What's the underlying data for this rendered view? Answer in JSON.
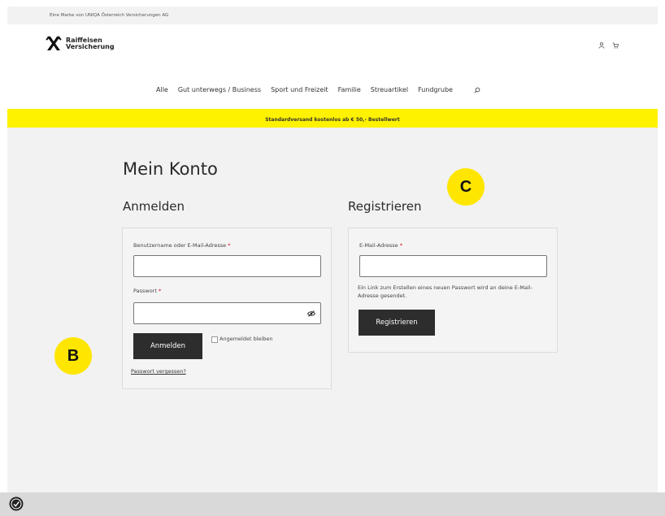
{
  "brandline": "Eine Marke von UNIQA Österreich Versicherungen AG",
  "logo": {
    "line1": "Raiffeisen",
    "line2": "Versicherung"
  },
  "header_icons": [
    "user-icon",
    "cart-icon"
  ],
  "nav": [
    "Alle",
    "Gut unterwegs / Business",
    "Sport und Freizeit",
    "Familie",
    "Streuartikel",
    "Fundgrube"
  ],
  "banner": "Standardversand kostenlos ab € 50,- Bestellwert",
  "page_title": "Mein Konto",
  "login": {
    "heading": "Anmelden",
    "username_label": "Benutzername oder E-Mail-Adresse",
    "password_label": "Passwort",
    "required_mark": "*",
    "submit": "Anmelden",
    "remember": "Angemeldet bleiben",
    "forgot": "Passwort vergessen?"
  },
  "register": {
    "heading": "Registrieren",
    "email_label": "E-Mail-Adresse",
    "required_mark": "*",
    "help": "Ein Link zum Erstellen eines neuen Passwort wird an deine E-Mail-Adresse gesendet.",
    "submit": "Registrieren"
  },
  "markers": {
    "b": "B",
    "c": "C"
  },
  "colors": {
    "banner": "#fff200",
    "button": "#2d2d2d",
    "required": "#d0021b",
    "marker": "#ffe600"
  }
}
